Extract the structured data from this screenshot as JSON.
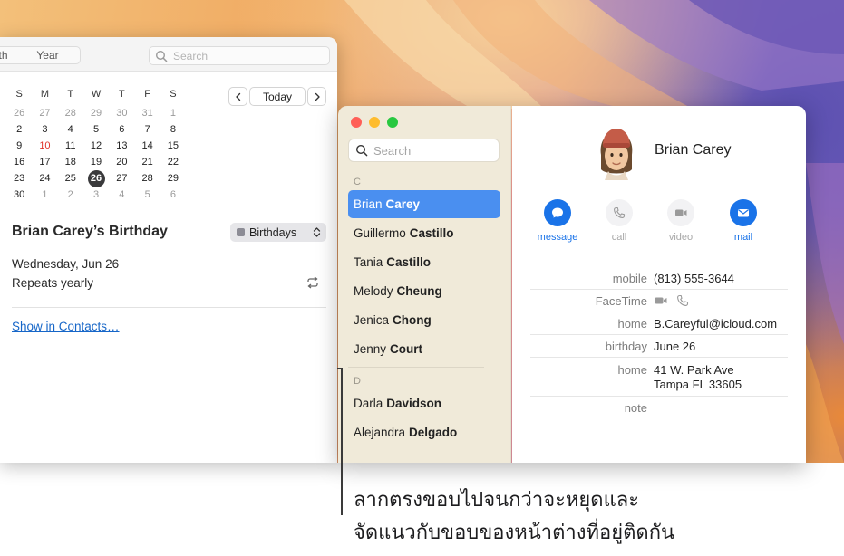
{
  "calendar": {
    "view_segments": [
      "th",
      "Year"
    ],
    "search_placeholder": "Search",
    "weekdays": [
      "S",
      "M",
      "T",
      "W",
      "T",
      "F",
      "S"
    ],
    "days": [
      {
        "d": "26",
        "state": "dim"
      },
      {
        "d": "27",
        "state": "dim"
      },
      {
        "d": "28",
        "state": "dim"
      },
      {
        "d": "29",
        "state": "dim"
      },
      {
        "d": "30",
        "state": "dim"
      },
      {
        "d": "31",
        "state": "dim"
      },
      {
        "d": "1",
        "state": "dim"
      },
      {
        "d": "2",
        "state": ""
      },
      {
        "d": "3",
        "state": ""
      },
      {
        "d": "4",
        "state": ""
      },
      {
        "d": "5",
        "state": ""
      },
      {
        "d": "6",
        "state": ""
      },
      {
        "d": "7",
        "state": ""
      },
      {
        "d": "8",
        "state": ""
      },
      {
        "d": "9",
        "state": ""
      },
      {
        "d": "10",
        "state": "today"
      },
      {
        "d": "11",
        "state": ""
      },
      {
        "d": "12",
        "state": ""
      },
      {
        "d": "13",
        "state": ""
      },
      {
        "d": "14",
        "state": ""
      },
      {
        "d": "15",
        "state": ""
      },
      {
        "d": "16",
        "state": ""
      },
      {
        "d": "17",
        "state": ""
      },
      {
        "d": "18",
        "state": ""
      },
      {
        "d": "19",
        "state": ""
      },
      {
        "d": "20",
        "state": ""
      },
      {
        "d": "21",
        "state": ""
      },
      {
        "d": "22",
        "state": ""
      },
      {
        "d": "23",
        "state": ""
      },
      {
        "d": "24",
        "state": ""
      },
      {
        "d": "25",
        "state": ""
      },
      {
        "d": "26",
        "state": "sel"
      },
      {
        "d": "27",
        "state": ""
      },
      {
        "d": "28",
        "state": ""
      },
      {
        "d": "29",
        "state": ""
      },
      {
        "d": "30",
        "state": ""
      },
      {
        "d": "1",
        "state": "dim"
      },
      {
        "d": "2",
        "state": "dim"
      },
      {
        "d": "3",
        "state": "dim"
      },
      {
        "d": "4",
        "state": "dim"
      },
      {
        "d": "5",
        "state": "dim"
      },
      {
        "d": "6",
        "state": "dim"
      }
    ],
    "today_label": "Today",
    "event": {
      "title": "Brian Carey’s Birthday",
      "calendar_name": "Birthdays",
      "date": "Wednesday, Jun 26",
      "repeat": "Repeats yearly",
      "show_in_contacts": "Show in Contacts…"
    }
  },
  "contacts": {
    "search_placeholder": "Search",
    "sections": [
      {
        "letter": "C",
        "items": [
          {
            "first": "Brian",
            "last": "Carey",
            "selected": true
          },
          {
            "first": "Guillermo",
            "last": "Castillo",
            "selected": false
          },
          {
            "first": "Tania",
            "last": "Castillo",
            "selected": false
          },
          {
            "first": "Melody",
            "last": "Cheung",
            "selected": false
          },
          {
            "first": "Jenica",
            "last": "Chong",
            "selected": false
          },
          {
            "first": "Jenny",
            "last": "Court",
            "selected": false
          }
        ]
      },
      {
        "letter": "D",
        "items": [
          {
            "first": "Darla",
            "last": "Davidson",
            "selected": false
          },
          {
            "first": "Alejandra",
            "last": "Delgado",
            "selected": false
          }
        ]
      }
    ],
    "detail": {
      "name": "Brian Carey",
      "actions": [
        {
          "label": "message",
          "icon": "message-icon",
          "enabled": true
        },
        {
          "label": "call",
          "icon": "phone-icon",
          "enabled": false
        },
        {
          "label": "video",
          "icon": "video-icon",
          "enabled": false
        },
        {
          "label": "mail",
          "icon": "mail-icon",
          "enabled": true
        }
      ],
      "fields": {
        "mobile_label": "mobile",
        "mobile_value": "(813) 555-3644",
        "facetime_label": "FaceTime",
        "email_label": "home",
        "email_value": "B.Careyful@icloud.com",
        "birthday_label": "birthday",
        "birthday_value": "June 26",
        "address_label": "home",
        "address_line1": "41 W. Park Ave",
        "address_line2": "Tampa FL 33605",
        "note_label": "note"
      }
    }
  },
  "callout": {
    "line1": "ลากตรงขอบไปจนกว่าจะหยุดและ",
    "line2": "จัดแนวกับขอบของหน้าต่างที่อยู่ติดกัน"
  },
  "colors": {
    "accent": "#1a73e8",
    "selection": "#4a8ff0",
    "today": "#e0322a",
    "sidebar": "#f0ead9"
  }
}
